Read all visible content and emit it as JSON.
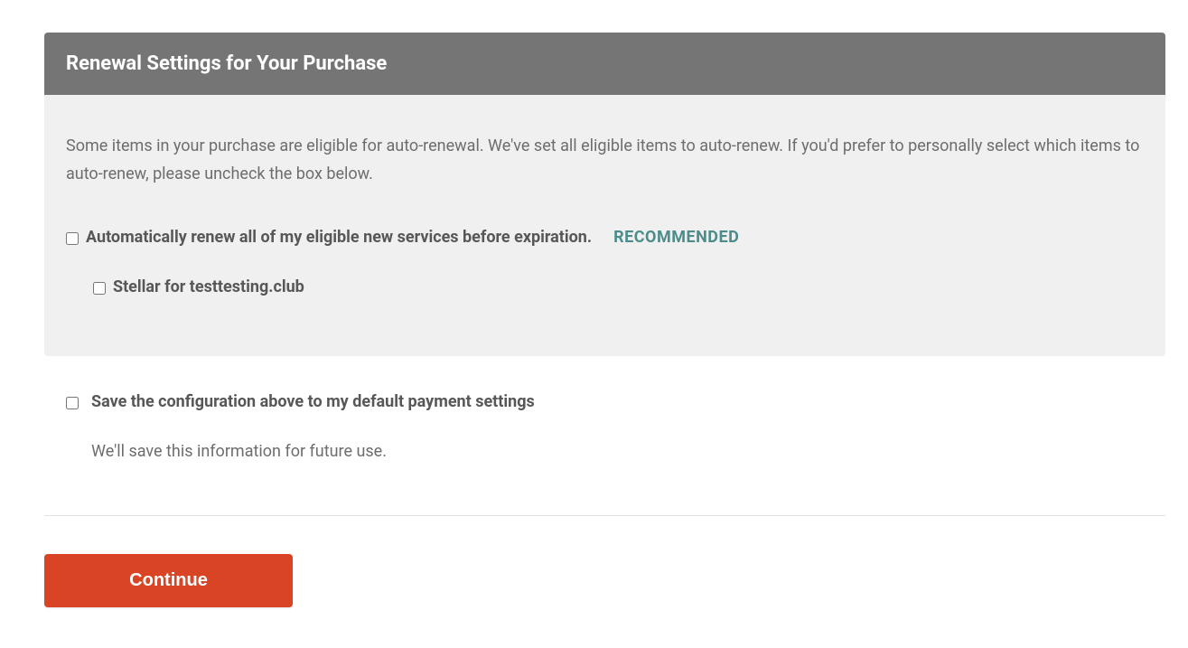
{
  "panel": {
    "title": "Renewal Settings for Your Purchase",
    "intro": "Some items in your purchase are eligible for auto-renewal. We've set all eligible items to auto-renew. If you'd prefer to personally select which items to auto-renew, please uncheck the box below.",
    "autoRenew": {
      "label": "Automatically renew all of my eligible new services before expiration.",
      "badge": "RECOMMENDED"
    },
    "items": [
      {
        "label": "Stellar for testtesting.club"
      }
    ]
  },
  "saveConfig": {
    "label": "Save the configuration above to my default payment settings",
    "note": "We'll save this information for future use."
  },
  "continue": {
    "label": "Continue"
  }
}
